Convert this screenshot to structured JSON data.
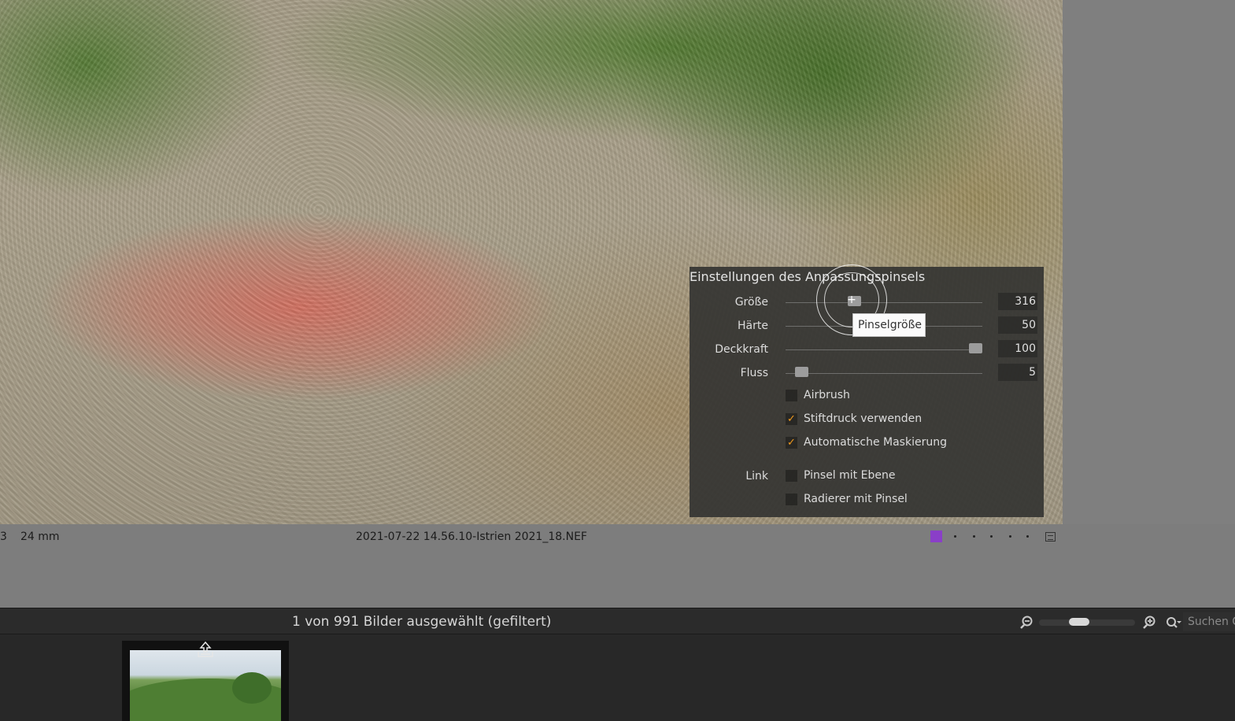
{
  "brush_panel": {
    "title": "Einstellungen des Anpassungspinsels",
    "sliders": [
      {
        "label": "Größe",
        "value": "316",
        "fraction": 0.34
      },
      {
        "label": "Härte",
        "value": "50",
        "fraction": 0.5
      },
      {
        "label": "Deckkraft",
        "value": "100",
        "fraction": 1.0
      },
      {
        "label": "Fluss",
        "value": "5",
        "fraction": 0.05
      }
    ],
    "checkboxes": [
      {
        "label": "Airbrush",
        "checked": false
      },
      {
        "label": "Stiftdruck verwenden",
        "checked": true
      },
      {
        "label": "Automatische Maskierung",
        "checked": true
      }
    ],
    "link_label": "Link",
    "link_checkboxes": [
      {
        "label": "Pinsel mit Ebene",
        "checked": false
      },
      {
        "label": "Radierer mit Pinsel",
        "checked": false
      }
    ],
    "tooltip": "Pinselgröße",
    "accent_color": "#f39b1c"
  },
  "info_strip": {
    "left_fragment": "3",
    "focal_length": "24 mm",
    "filename": "2021-07-22 14.56.10-Istrien 2021_18.NEF",
    "color_label": "#8a3fc8"
  },
  "filmstrip": {
    "status": "1 von 991 Bilder ausgewählt (gefiltert)",
    "search_placeholder": "Suchen C",
    "zoom_level": 0.4
  }
}
